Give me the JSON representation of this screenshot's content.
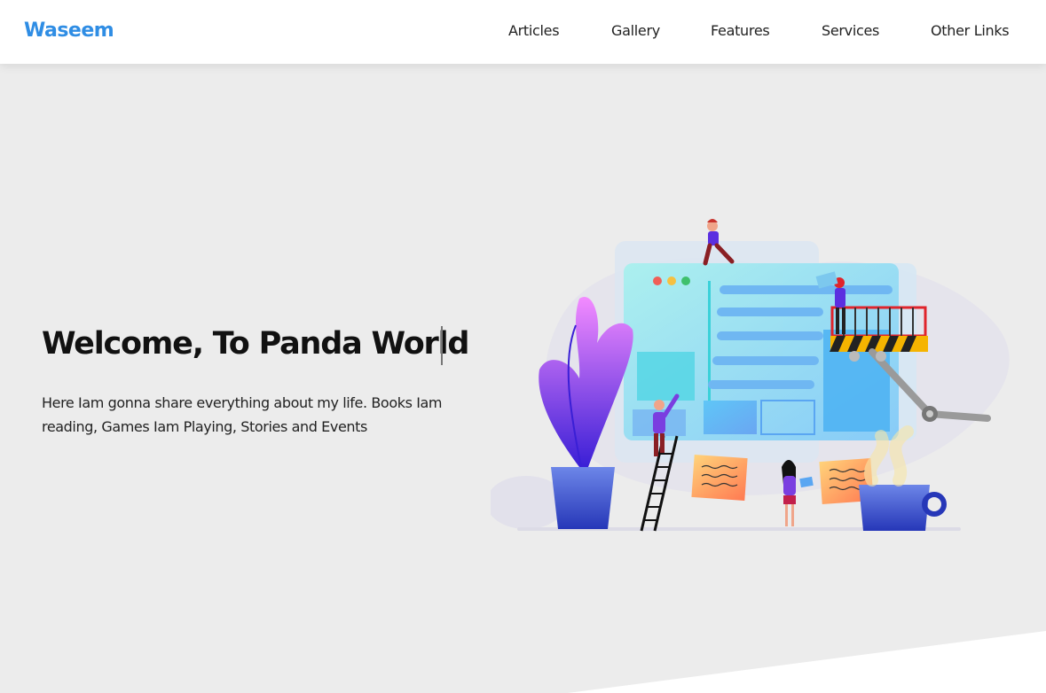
{
  "header": {
    "logo": "Waseem",
    "nav": [
      {
        "label": "Articles"
      },
      {
        "label": "Gallery"
      },
      {
        "label": "Features"
      },
      {
        "label": "Services"
      },
      {
        "label": "Other Links"
      }
    ]
  },
  "hero": {
    "title": "Welcome, To Panda World",
    "description": "Here Iam gonna share everything about my life. Books Iam reading, Games Iam Playing, Stories and Events"
  },
  "colors": {
    "brand": "#2f8de4",
    "hero_background": "#ececec",
    "text": "#111111"
  },
  "illustration": {
    "name": "website-builders-illustration"
  }
}
